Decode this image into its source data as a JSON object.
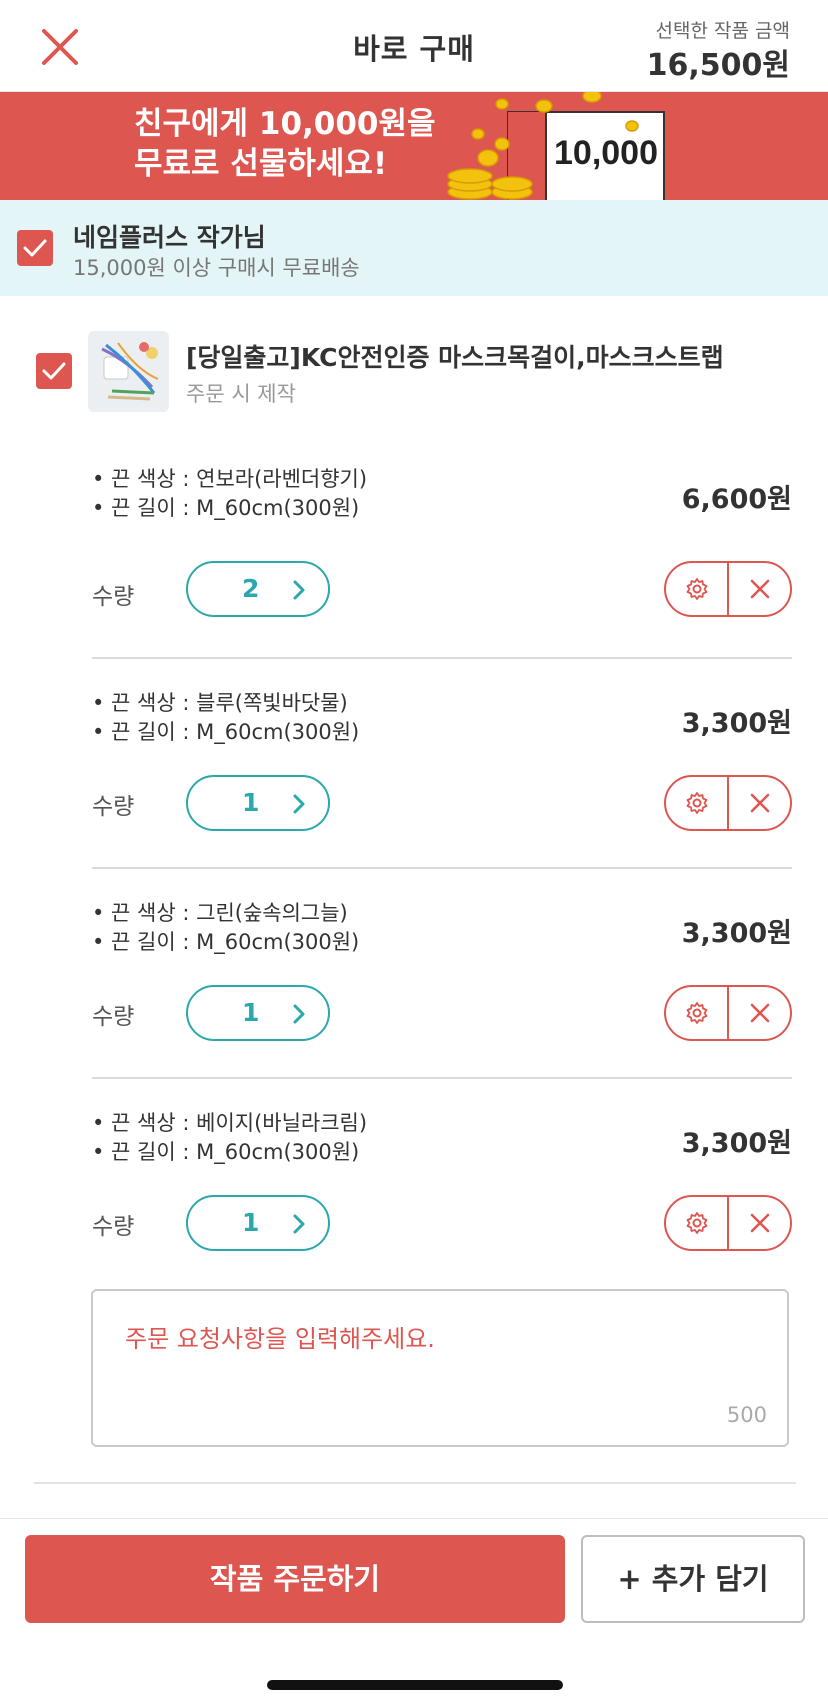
{
  "header": {
    "title": "바로 구매",
    "price_caption": "선택한 작품 금액",
    "price_total": "16,500원"
  },
  "banner": {
    "line1": "친구에게 10,000원을",
    "line2": "무료로 선물하세요!",
    "card_value": "10,000"
  },
  "seller": {
    "name": "네임플러스 작가님",
    "shipping": "15,000원 이상 구매시 무료배송"
  },
  "product": {
    "title": "[당일출고]KC안전인증 마스크목걸이,마스크스트랩",
    "subtitle": "주문 시 제작"
  },
  "options": [
    {
      "color": "• 끈 색상 : 연보라(라벤더향기)",
      "length": "• 끈 길이 : M_60cm(300원)",
      "price": "6,600원",
      "qty_label": "수량",
      "qty": "2"
    },
    {
      "color": "• 끈 색상 : 블루(쪽빛바닷물)",
      "length": "• 끈 길이 : M_60cm(300원)",
      "price": "3,300원",
      "qty_label": "수량",
      "qty": "1"
    },
    {
      "color": "• 끈 색상 : 그린(숲속의그늘)",
      "length": "• 끈 길이 : M_60cm(300원)",
      "price": "3,300원",
      "qty_label": "수량",
      "qty": "1"
    },
    {
      "color": "• 끈 색상 : 베이지(바닐라크림)",
      "length": "• 끈 길이 : M_60cm(300원)",
      "price": "3,300원",
      "qty_label": "수량",
      "qty": "1"
    }
  ],
  "request": {
    "placeholder": "주문 요청사항을 입력해주세요.",
    "max_length": "500"
  },
  "buttons": {
    "order": "작품 주문하기",
    "add": "+ 추가 담기"
  },
  "colors": {
    "accent_red": "#dd5650",
    "teal": "#29a8ad",
    "seller_bg": "#e3f5f6"
  },
  "icons": {
    "close": "close-icon",
    "checkbox": "checkmark-icon",
    "stepper": "chevron-right-icon",
    "option_settings": "gear-icon",
    "option_delete": "close-icon"
  }
}
